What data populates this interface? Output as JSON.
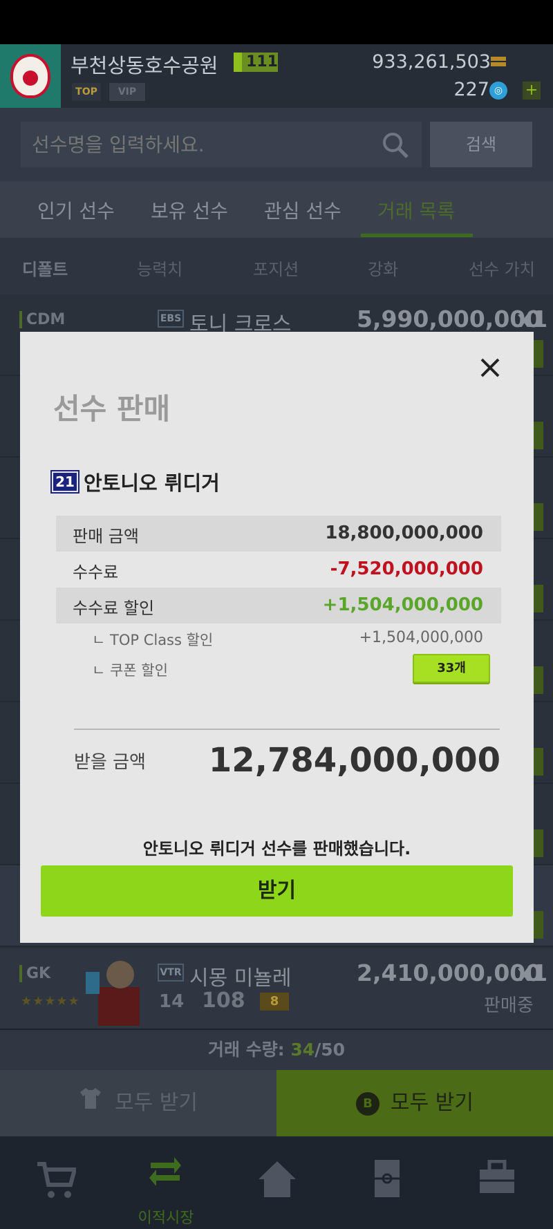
{
  "header": {
    "club_name": "부천상동호수공원",
    "level": "111",
    "top_badge": "TOP",
    "vip_badge": "VIP",
    "coins": "933,261,503",
    "points": "227"
  },
  "search": {
    "placeholder": "선수명을 입력하세요.",
    "button": "검색"
  },
  "tabs": [
    "인기 선수",
    "보유 선수",
    "관심 선수",
    "거래 목록"
  ],
  "sort": [
    "디폴트",
    "능력치",
    "포지션",
    "강화",
    "선수 가치"
  ],
  "list": {
    "first_row": {
      "position": "CDM",
      "season": "EBS",
      "name": "토니 크로스",
      "price": "5,990,000,000",
      "qty": "x1"
    },
    "gk_row": {
      "position": "GK",
      "season": "VTR",
      "name": "시몽 미뇰레",
      "price": "2,410,000,000",
      "qty": "x1",
      "ovr": "14",
      "num": "108",
      "level": "8",
      "stars": "★★★★★",
      "status": "판매중"
    }
  },
  "trade_count": {
    "label": "거래 수량: ",
    "current": "34",
    "max": "/50"
  },
  "bottom_buttons": {
    "receive_all_left": "모두 받기",
    "receive_all_right": "모두 받기",
    "b_letter": "B"
  },
  "nav": {
    "transfer_market": "이적시장"
  },
  "modal": {
    "title": "선수 판매",
    "season_badge": "21",
    "player_name": "안토니오 뤼디거",
    "sale_amount_label": "판매 금액",
    "sale_amount": "18,800,000,000",
    "fee_label": "수수료",
    "fee": "-7,520,000,000",
    "fee_discount_label": "수수료 할인",
    "fee_discount": "+1,504,000,000",
    "top_class_label": "ㄴ TOP Class 할인",
    "top_class_value": "+1,504,000,000",
    "coupon_label": "ㄴ 쿠폰 할인",
    "coupon_button": "33개",
    "receive_label": "받을 금액",
    "receive_amount": "12,784,000,000",
    "sold_message": "안토니오 뤼디거 선수를 판매했습니다.",
    "receive_button": "받기"
  }
}
